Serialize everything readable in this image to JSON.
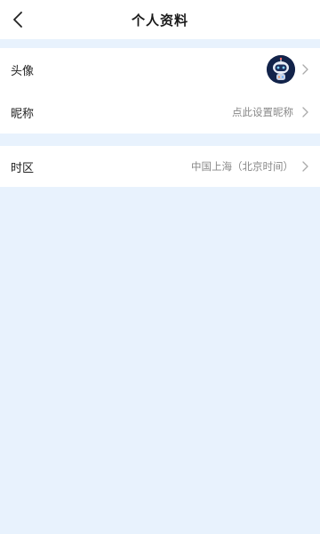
{
  "header": {
    "title": "个人资料"
  },
  "profile": {
    "avatar_label": "头像",
    "nickname_label": "昵称",
    "nickname_value": "点此设置昵称"
  },
  "settings": {
    "timezone_label": "时区",
    "timezone_value": "中国上海（北京时间）"
  },
  "icons": {
    "back": "chevron-left-icon",
    "row_arrow": "chevron-right-icon",
    "avatar": "robot-avatar"
  },
  "colors": {
    "background": "#e8f2fd",
    "card": "#ffffff",
    "secondary_text": "#888888",
    "avatar_bg": "#12234a"
  }
}
